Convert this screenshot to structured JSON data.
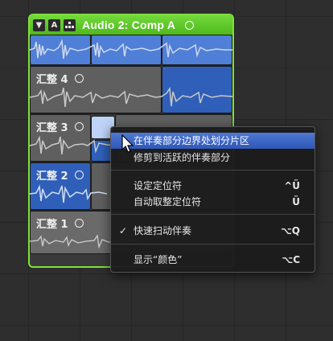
{
  "folder": {
    "title": "Audio 2: Comp A",
    "buttons": {
      "disclosure": "▼",
      "a": "A",
      "flatten": "⛬"
    }
  },
  "lanes": [
    {
      "label": "汇整 4"
    },
    {
      "label": "汇整 3"
    },
    {
      "label": "汇整 2"
    },
    {
      "label": "汇整 1"
    }
  ],
  "menu": {
    "items": [
      {
        "label": "在伴奏部分边界处划分片区",
        "shortcut": "",
        "checked": false
      },
      {
        "label": "修剪到活跃的伴奏部分",
        "shortcut": "",
        "checked": false
      },
      {
        "label": "设定定位符",
        "shortcut": "^Ü",
        "checked": false
      },
      {
        "label": "自动取整定位符",
        "shortcut": "Ü",
        "checked": false
      },
      {
        "label": "快速扫动伴奏",
        "shortcut": "⌥Q",
        "checked": true,
        "check_mark": "✓"
      },
      {
        "label": "显示“颜色”",
        "shortcut": "⌥C",
        "checked": false
      }
    ]
  },
  "colors": {
    "folder_border": "#7fe13a",
    "selection": "#2f5fb8",
    "menu_highlight": "#3b64c4"
  }
}
